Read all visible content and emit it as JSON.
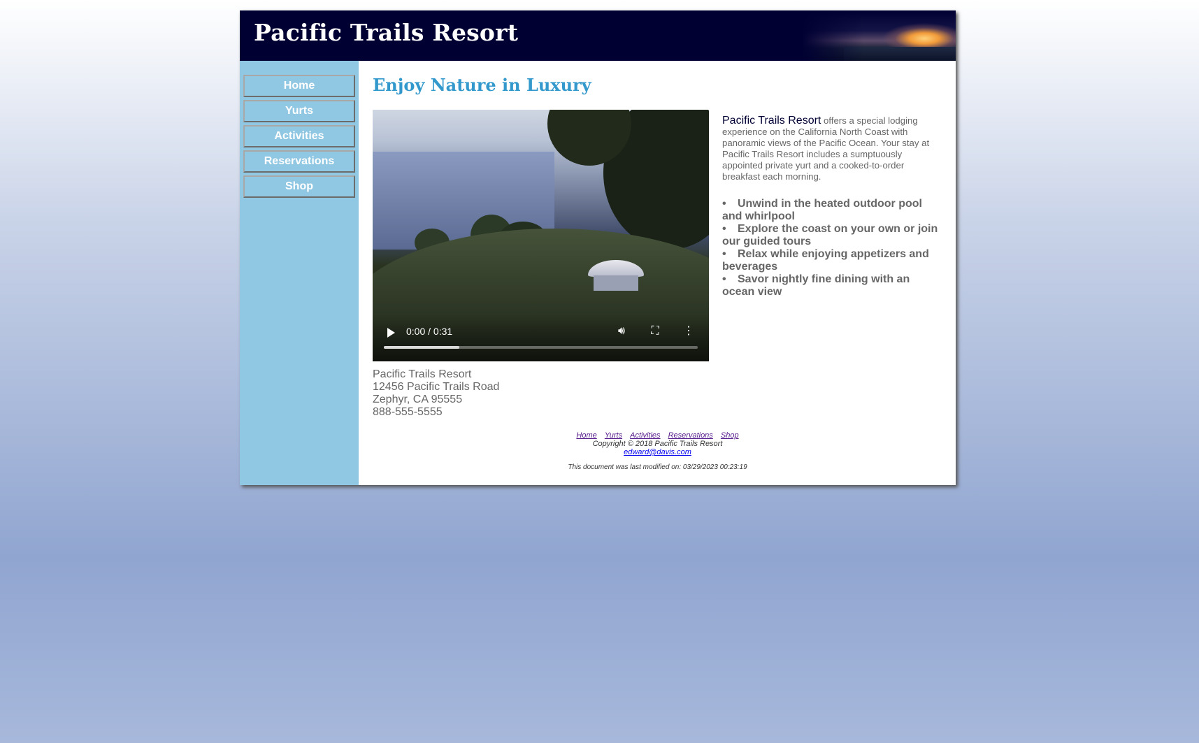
{
  "header": {
    "title": "Pacific Trails Resort"
  },
  "nav": {
    "items": [
      "Home",
      "Yurts",
      "Activities",
      "Reservations",
      "Shop"
    ]
  },
  "main": {
    "heading": "Enjoy Nature in Luxury",
    "video": {
      "time": "0:00 / 0:31",
      "progress": 0.24
    },
    "intro_lead": "Pacific Trails Resort",
    "intro_rest": " offers a special lodging experience on the California North Coast with panoramic views of the Pacific Ocean. Your stay at Pacific Trails Resort includes a sumptuously appointed private yurt and a cooked-to-order breakfast each morning.",
    "features": [
      "Unwind in the heated outdoor pool and whirlpool",
      "Explore the coast on your own or join our guided tours",
      "Relax while enjoying appetizers and beverages",
      "Savor nightly fine dining with an ocean view"
    ],
    "address": {
      "name": "Pacific Trails Resort",
      "street": "12456 Pacific Trails Road",
      "city": "Zephyr, CA 95555",
      "phone": "888-555-5555"
    }
  },
  "footer": {
    "links": [
      "Home",
      "Yurts",
      "Activities",
      "Reservations",
      "Shop"
    ],
    "copyright": "Copyright © 2018 Pacific Trails Resort",
    "email": "edward@davis.com",
    "modified": "This document was last modified on: 03/29/2023 00:23:19"
  }
}
